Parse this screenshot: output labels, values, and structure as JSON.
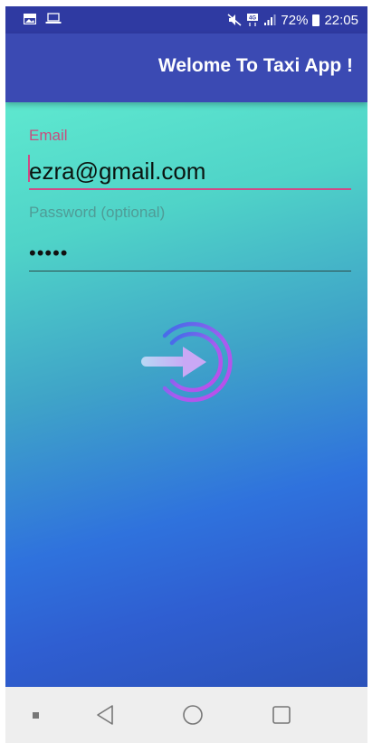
{
  "status_bar": {
    "battery_percent": "72%",
    "time": "22:05",
    "network_badge": "4G"
  },
  "app_bar": {
    "title": "Welome To Taxi App !"
  },
  "form": {
    "email_label": "Email",
    "email_value": "ezra@gmail.com",
    "password_label": "Password (optional)",
    "password_value": "12345"
  },
  "login_button": {
    "icon": "login-arrow-icon",
    "gradient": [
      "#3a6ee8",
      "#a85cf0",
      "#c04be8"
    ]
  },
  "navigation": {
    "items": [
      "recents-dot",
      "back",
      "home",
      "overview"
    ]
  },
  "colors": {
    "status_bar": "#2f3aa2",
    "app_bar": "#3b4ab3",
    "email_accent": "#cf4a86",
    "password_label": "#4f9c97",
    "nav_bar": "#eeeeee"
  }
}
